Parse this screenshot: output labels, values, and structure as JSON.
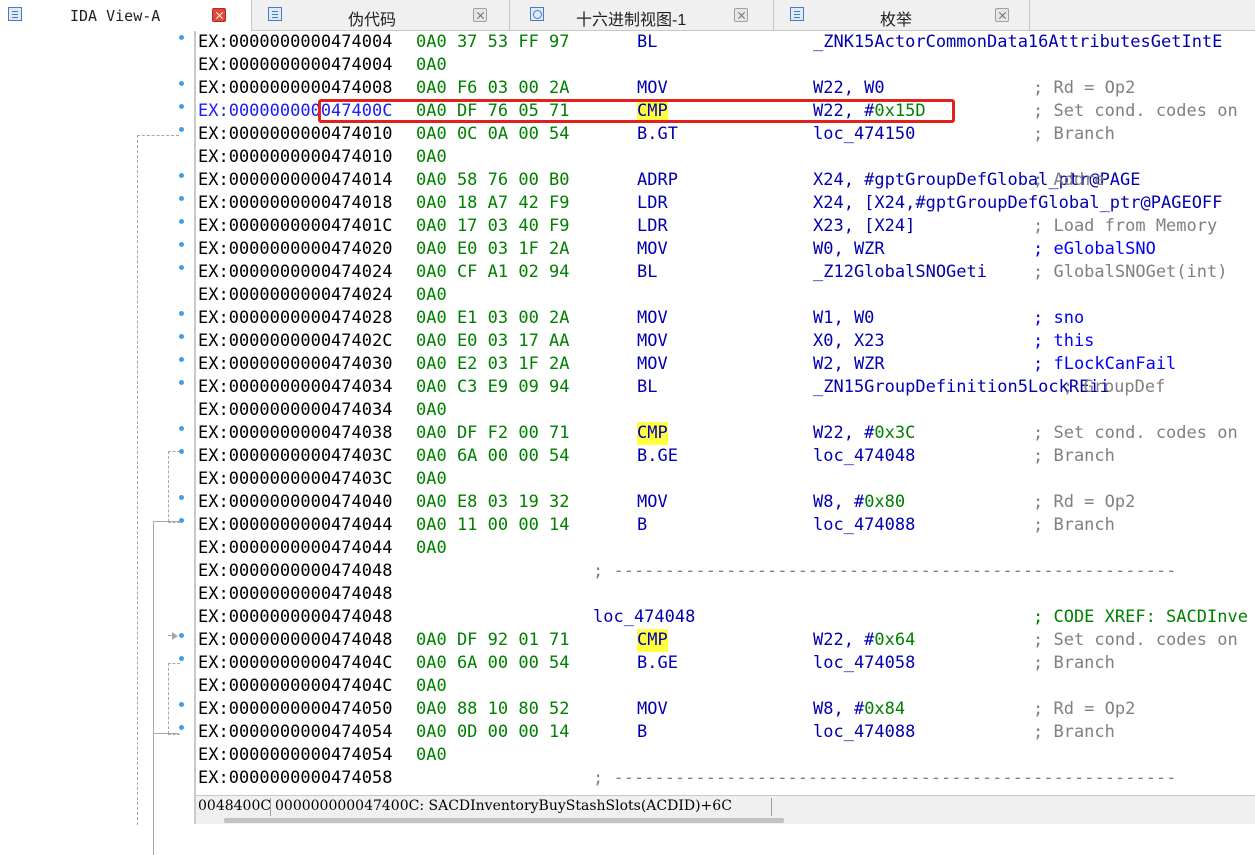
{
  "tabs": [
    {
      "label": "IDA View-A",
      "icon": "list-view-icon",
      "active": true,
      "close_style": "red"
    },
    {
      "label": "伪代码",
      "icon": "pseudocode-icon",
      "active": false
    },
    {
      "label": "十六进制视图-1",
      "icon": "hex-view-icon",
      "active": false
    },
    {
      "label": "枚举",
      "icon": "enum-icon",
      "active": false
    }
  ],
  "listing": [
    {
      "addr": "EX:0000000000474004",
      "bytes": "0A0 37 53 FF 97",
      "mnem": "BL",
      "ops": [
        [
          "_ZNK15ActorCommonData16AttributesGetIntE",
          "t"
        ]
      ],
      "cmt": ""
    },
    {
      "addr": "EX:0000000000474004",
      "bytes": "0A0",
      "mnem": "",
      "ops": [],
      "cmt": ""
    },
    {
      "addr": "EX:0000000000474008",
      "bytes": "0A0 F6 03 00 2A",
      "mnem": "MOV",
      "ops": [
        [
          "W22, W0",
          "t"
        ]
      ],
      "cmt": "; Rd = Op2",
      "cmt_color": "gray"
    },
    {
      "addr": "EX:000000000047400C",
      "bytes": "0A0 DF 76 05 71",
      "mnem": "CMP",
      "ops": [
        [
          "W22, #",
          "t"
        ],
        [
          "0x15D",
          "n"
        ]
      ],
      "cmt": "; Set cond. codes on",
      "cmt_color": "gray",
      "current": true,
      "highlight": true
    },
    {
      "addr": "EX:0000000000474010",
      "bytes": "0A0 0C 0A 00 54",
      "mnem": "B.GT",
      "ops": [
        [
          "loc_474150",
          "t"
        ]
      ],
      "cmt": "; Branch",
      "cmt_color": "gray"
    },
    {
      "addr": "EX:0000000000474010",
      "bytes": "0A0",
      "mnem": "",
      "ops": [],
      "cmt": ""
    },
    {
      "addr": "EX:0000000000474014",
      "bytes": "0A0 58 76 00 B0",
      "mnem": "ADRP",
      "ops": [
        [
          "X24, #gptGroupDefGlobal_ptr@PAGE",
          "t"
        ]
      ],
      "cmt": "; Addre",
      "cmt_color": "gray"
    },
    {
      "addr": "EX:0000000000474018",
      "bytes": "0A0 18 A7 42 F9",
      "mnem": "LDR",
      "ops": [
        [
          "X24, [X24,#gptGroupDefGlobal_ptr@PAGEOFF",
          "t"
        ]
      ],
      "cmt": ""
    },
    {
      "addr": "EX:000000000047401C",
      "bytes": "0A0 17 03 40 F9",
      "mnem": "LDR",
      "ops": [
        [
          "X23, [X24]",
          "t"
        ]
      ],
      "cmt": "; Load from Memory",
      "cmt_color": "gray"
    },
    {
      "addr": "EX:0000000000474020",
      "bytes": "0A0 E0 03 1F 2A",
      "mnem": "MOV",
      "ops": [
        [
          "W0, WZR",
          "t"
        ]
      ],
      "cmt": "; eGlobalSNO",
      "cmt_color": "blue"
    },
    {
      "addr": "EX:0000000000474024",
      "bytes": "0A0 CF A1 02 94",
      "mnem": "BL",
      "ops": [
        [
          "_Z12GlobalSNOGeti",
          "t"
        ]
      ],
      "cmt": "; GlobalSNOGet(int)",
      "cmt_color": "gray"
    },
    {
      "addr": "EX:0000000000474024",
      "bytes": "0A0",
      "mnem": "",
      "ops": [],
      "cmt": ""
    },
    {
      "addr": "EX:0000000000474028",
      "bytes": "0A0 E1 03 00 2A",
      "mnem": "MOV",
      "ops": [
        [
          "W1, W0",
          "t"
        ]
      ],
      "cmt": "; sno",
      "cmt_color": "blue"
    },
    {
      "addr": "EX:000000000047402C",
      "bytes": "0A0 E0 03 17 AA",
      "mnem": "MOV",
      "ops": [
        [
          "X0, X23",
          "t"
        ]
      ],
      "cmt": "; this",
      "cmt_color": "blue"
    },
    {
      "addr": "EX:0000000000474030",
      "bytes": "0A0 E2 03 1F 2A",
      "mnem": "MOV",
      "ops": [
        [
          "W2, WZR",
          "t"
        ]
      ],
      "cmt": "; fLockCanFail",
      "cmt_color": "blue"
    },
    {
      "addr": "EX:0000000000474034",
      "bytes": "0A0 C3 E9 09 94",
      "mnem": "BL",
      "ops": [
        [
          "_ZN15GroupDefinition5LockREii",
          "t"
        ]
      ],
      "cmt": "; GroupDef",
      "cmt_color": "gray",
      "cmt_shift": 30
    },
    {
      "addr": "EX:0000000000474034",
      "bytes": "0A0",
      "mnem": "",
      "ops": [],
      "cmt": ""
    },
    {
      "addr": "EX:0000000000474038",
      "bytes": "0A0 DF F2 00 71",
      "mnem": "CMP",
      "ops": [
        [
          "W22, #",
          "t"
        ],
        [
          "0x3C",
          "n"
        ]
      ],
      "cmt": "; Set cond. codes on",
      "cmt_color": "gray",
      "highlight": true
    },
    {
      "addr": "EX:000000000047403C",
      "bytes": "0A0 6A 00 00 54",
      "mnem": "B.GE",
      "ops": [
        [
          "loc_474048",
          "t"
        ]
      ],
      "cmt": "; Branch",
      "cmt_color": "gray"
    },
    {
      "addr": "EX:000000000047403C",
      "bytes": "0A0",
      "mnem": "",
      "ops": [],
      "cmt": ""
    },
    {
      "addr": "EX:0000000000474040",
      "bytes": "0A0 E8 03 19 32",
      "mnem": "MOV",
      "ops": [
        [
          "W8, #",
          "t"
        ],
        [
          "0x80",
          "n"
        ]
      ],
      "cmt": "; Rd = Op2",
      "cmt_color": "gray"
    },
    {
      "addr": "EX:0000000000474044",
      "bytes": "0A0 11 00 00 14",
      "mnem": "B",
      "ops": [
        [
          "loc_474088",
          "t"
        ]
      ],
      "cmt": "; Branch",
      "cmt_color": "gray"
    },
    {
      "addr": "EX:0000000000474044",
      "bytes": "0A0",
      "mnem": "",
      "ops": [],
      "cmt": ""
    },
    {
      "addr": "EX:0000000000474048",
      "bytes": "",
      "mnem": "",
      "ops": [],
      "cmt": "",
      "sep": "; -------------------------------------------------------"
    },
    {
      "addr": "EX:0000000000474048",
      "bytes": "",
      "mnem": "",
      "ops": [],
      "cmt": ""
    },
    {
      "addr": "EX:0000000000474048",
      "bytes": "",
      "mnem": "",
      "ops": [],
      "label": "loc_474048",
      "cmt": "; CODE XREF: SACDInve",
      "cmt_color": "green"
    },
    {
      "addr": "EX:0000000000474048",
      "bytes": "0A0 DF 92 01 71",
      "mnem": "CMP",
      "ops": [
        [
          "W22, #",
          "t"
        ],
        [
          "0x64",
          "n"
        ]
      ],
      "cmt": "; Set cond. codes on",
      "cmt_color": "gray",
      "highlight": true
    },
    {
      "addr": "EX:000000000047404C",
      "bytes": "0A0 6A 00 00 54",
      "mnem": "B.GE",
      "ops": [
        [
          "loc_474058",
          "t"
        ]
      ],
      "cmt": "; Branch",
      "cmt_color": "gray"
    },
    {
      "addr": "EX:000000000047404C",
      "bytes": "0A0",
      "mnem": "",
      "ops": [],
      "cmt": ""
    },
    {
      "addr": "EX:0000000000474050",
      "bytes": "0A0 88 10 80 52",
      "mnem": "MOV",
      "ops": [
        [
          "W8, #",
          "t"
        ],
        [
          "0x84",
          "n"
        ]
      ],
      "cmt": "; Rd = Op2",
      "cmt_color": "gray"
    },
    {
      "addr": "EX:0000000000474054",
      "bytes": "0A0 0D 00 00 14",
      "mnem": "B",
      "ops": [
        [
          "loc_474088",
          "t"
        ]
      ],
      "cmt": "; Branch",
      "cmt_color": "gray"
    },
    {
      "addr": "EX:0000000000474054",
      "bytes": "0A0",
      "mnem": "",
      "ops": [],
      "cmt": ""
    },
    {
      "addr": "EX:0000000000474058",
      "bytes": "",
      "mnem": "",
      "ops": [],
      "cmt": "",
      "sep": "; -------------------------------------------------------"
    }
  ],
  "status": {
    "offset": "0048400C",
    "location": "000000000047400C: SACDInventoryBuyStashSlots(ACDID)+6C"
  },
  "colors": {
    "address": "#000000",
    "current_address": "#1a1aff",
    "bytes": "#008000",
    "mnemonic": "#0000b0",
    "comment": "#808080",
    "highlight": "#ffff40",
    "selection_box": "#e3211c"
  }
}
